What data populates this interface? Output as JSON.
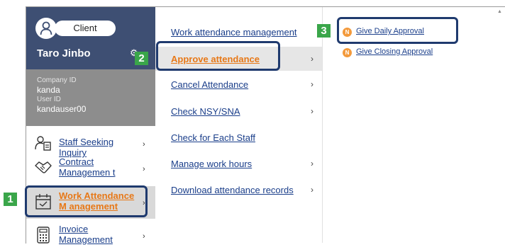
{
  "user": {
    "role": "Client",
    "name": "Taro Jinbo",
    "company_id_label": "Company ID",
    "company_id": "kanda",
    "user_id_label": "User ID",
    "user_id": "kandauser00"
  },
  "sidebar": {
    "items": [
      {
        "label": "Staff Seeking Inquiry",
        "icon": "person-document-icon"
      },
      {
        "label": "Contract Managemen t",
        "icon": "handshake-icon"
      },
      {
        "label": "Work Attendance M anagement",
        "icon": "calendar-check-icon",
        "active": true
      },
      {
        "label": "Invoice Management",
        "icon": "calculator-icon"
      }
    ]
  },
  "submenu": {
    "items": [
      {
        "label": "Work attendance management",
        "has_children": false
      },
      {
        "label": "Approve attendance",
        "has_children": true,
        "active": true
      },
      {
        "label": "Cancel Attendance",
        "has_children": true
      },
      {
        "label": "Check NSY/SNA",
        "has_children": true
      },
      {
        "label": "Check for Each Staff",
        "has_children": false
      },
      {
        "label": "Manage work hours",
        "has_children": true
      },
      {
        "label": "Download attendance records",
        "has_children": true
      }
    ]
  },
  "subsubmenu": {
    "badge": "N",
    "items": [
      {
        "label": "Give Daily Approval"
      },
      {
        "label": "Give Closing Approval"
      }
    ]
  },
  "steps": [
    "1",
    "2",
    "3"
  ],
  "colors": {
    "header": "#3e4f73",
    "id_panel": "#8d8d8d",
    "accent": "#e77817",
    "link": "#1a3e8a",
    "step": "#3aa64a",
    "callout": "#1f3a6e"
  }
}
